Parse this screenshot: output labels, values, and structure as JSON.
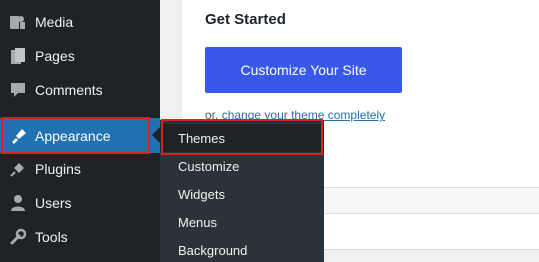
{
  "sidebar": {
    "items": [
      {
        "label": "Media",
        "icon": "media-icon"
      },
      {
        "label": "Pages",
        "icon": "pages-icon"
      },
      {
        "label": "Comments",
        "icon": "comments-icon"
      },
      {
        "label": "Appearance",
        "icon": "appearance-icon",
        "active": true
      },
      {
        "label": "Plugins",
        "icon": "plugins-icon"
      },
      {
        "label": "Users",
        "icon": "users-icon"
      },
      {
        "label": "Tools",
        "icon": "tools-icon"
      }
    ]
  },
  "submenu": {
    "items": [
      "Themes",
      "Customize",
      "Widgets",
      "Menus",
      "Background"
    ]
  },
  "main": {
    "title": "Get Started",
    "cta_label": "Customize Your Site",
    "or_prefix": "or,",
    "or_link": "change your theme completely"
  },
  "colors": {
    "sidebar_bg": "#1d2327",
    "active_bg": "#2271b1",
    "cta_bg": "#3858e9",
    "highlight": "#e02020",
    "link": "#2271b1"
  }
}
